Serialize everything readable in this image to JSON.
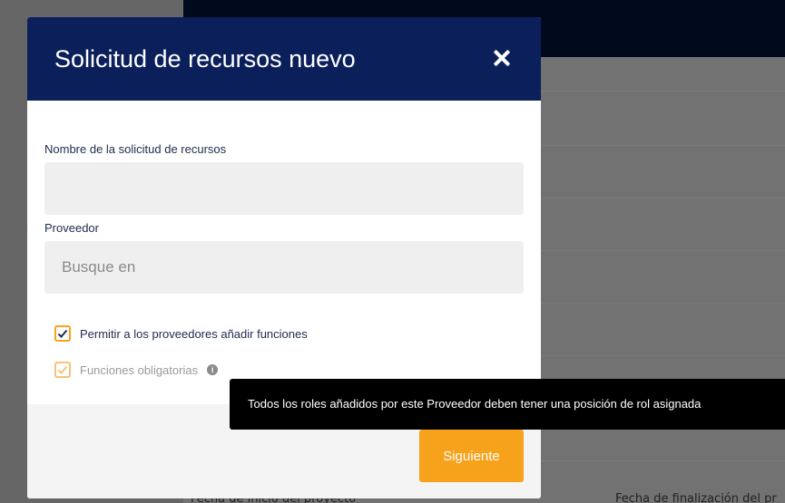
{
  "modal": {
    "title": "Solicitud de recursos nuevo",
    "fields": {
      "name": {
        "label": "Nombre de la solicitud de recursos",
        "value": "",
        "placeholder": ""
      },
      "provider": {
        "label": "Proveedor",
        "value": "",
        "placeholder": "Busque en"
      }
    },
    "checkboxes": {
      "allow_add_functions": {
        "label": "Permitir a los proveedores añadir funciones",
        "checked": true,
        "enabled": true
      },
      "mandatory_functions": {
        "label": "Funciones obligatorias",
        "checked": true,
        "enabled": false
      }
    },
    "next_label": "Siguiente"
  },
  "tooltip": {
    "text": "Todos los roles añadidos por este Proveedor deben tener una posición de rol asignada"
  },
  "background": {
    "start_date_label": "Fecha de inicio del proyecto",
    "end_date_label": "Fecha de finalización del pr"
  },
  "icons": {
    "close": "close-icon",
    "check": "check-icon",
    "info": "info-icon"
  },
  "colors": {
    "header_bg": "#0b1f5b",
    "accent": "#f7a21b",
    "tooltip_bg": "#000000"
  }
}
